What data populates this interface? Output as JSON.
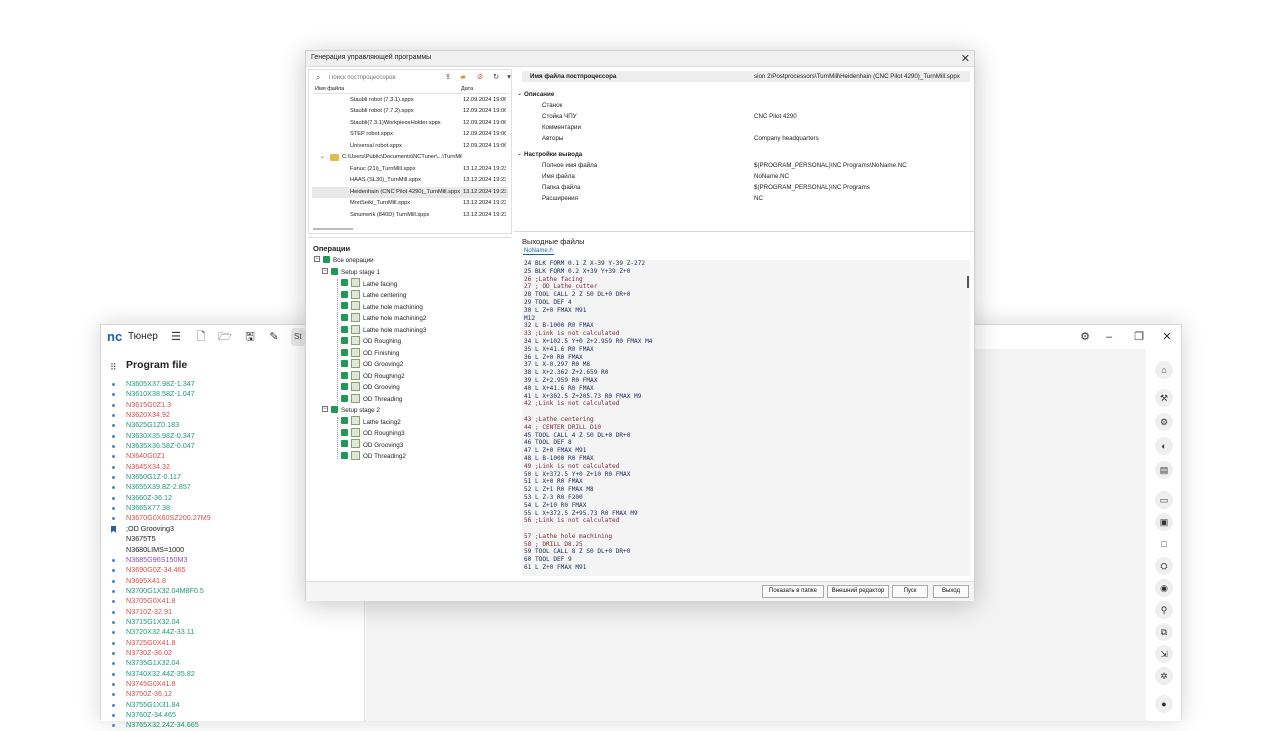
{
  "app": {
    "title": "Тюнер",
    "tab_label": "St",
    "icons": [
      "menu-icon",
      "new-file-icon",
      "open-folder-icon",
      "save-icon",
      "edit-icon"
    ],
    "program_panel": {
      "title": "Program file",
      "lines": [
        {
          "text": "N3605X37.98Z-1.347",
          "color": "green"
        },
        {
          "text": "N3610X38.58Z-1.047",
          "color": "green"
        },
        {
          "text": "N3615G0Z1.3",
          "color": "red"
        },
        {
          "text": "N3620X34.92",
          "color": "red"
        },
        {
          "text": "N3625G1Z0.183",
          "color": "green"
        },
        {
          "text": "N3630X35.98Z-0.347",
          "color": "green"
        },
        {
          "text": "N3635X36.58Z-0.047",
          "color": "green"
        },
        {
          "text": "N3640G0Z1",
          "color": "red"
        },
        {
          "text": "N3645X34.32",
          "color": "red"
        },
        {
          "text": "N3650G1Z-0.117",
          "color": "green"
        },
        {
          "text": "N3655X39.8Z-2.857",
          "color": "green"
        },
        {
          "text": "N3660Z-36.12",
          "color": "green"
        },
        {
          "text": "N3665X77.38",
          "color": "green"
        },
        {
          "text": "N3670G0X60SZ200.27M9",
          "color": "red"
        },
        {
          "text": ";OD Grooving3",
          "color": "dark",
          "bookmark": true
        },
        {
          "text": "N3675T5",
          "color": "dark",
          "nobullet": true
        },
        {
          "text": "N3680LIMS=1000",
          "color": "dark",
          "nobullet": true
        },
        {
          "text": "N3685G96S150M3",
          "color": "purple"
        },
        {
          "text": "N3690G0Z-34.465",
          "color": "red"
        },
        {
          "text": "N3695X41.8",
          "color": "red"
        },
        {
          "text": "N3700G1X32.04M8F0.5",
          "color": "green"
        },
        {
          "text": "N3705G0X41.8",
          "color": "red"
        },
        {
          "text": "N3710Z-32.91",
          "color": "red"
        },
        {
          "text": "N3715G1X32.04",
          "color": "green"
        },
        {
          "text": "N3720X32.44Z-33.11",
          "color": "green"
        },
        {
          "text": "N3725G0X41.8",
          "color": "red"
        },
        {
          "text": "N3730Z-36.02",
          "color": "red"
        },
        {
          "text": "N3735G1X32.04",
          "color": "green"
        },
        {
          "text": "N3740X32.44Z-35.82",
          "color": "green"
        },
        {
          "text": "N3745G0X41.8",
          "color": "red"
        },
        {
          "text": "N3750Z-36.12",
          "color": "red"
        },
        {
          "text": "N3755G1X31.84",
          "color": "green"
        },
        {
          "text": "N3760Z-34.465",
          "color": "green"
        },
        {
          "text": "N3765X32.24Z-34.665",
          "color": "green"
        }
      ]
    }
  },
  "dialog": {
    "title": "Генерация управляющей программы",
    "search_placeholder": "Поиск постпроцессоров",
    "pp_headers": {
      "name": "Имя файла",
      "date": "Дата"
    },
    "pp_files": [
      {
        "name": "Staubli robot (7.3.1).sppx",
        "date": "12.09.2024 19:06"
      },
      {
        "name": "Staubli robot (7.7.2).sppx",
        "date": "12.09.2024 19:06"
      },
      {
        "name": "Staubli(7.3.1)WorkpieceHolder.sppx",
        "date": "12.09.2024 19:06"
      },
      {
        "name": "STEP robot.sppx",
        "date": "12.09.2024 19:06"
      },
      {
        "name": "Universal robot.sppx",
        "date": "12.09.2024 19:06"
      },
      {
        "name": "C:\\Users\\Public\\Documents\\NCTuner\\...\\TurnMill",
        "date": "",
        "folder": true
      },
      {
        "name": "Fanuc (21i)_TurnMill.sppx",
        "date": "13.12.2024 19:23"
      },
      {
        "name": "HAAS (SL30)_TurnMill.sppx",
        "date": "13.12.2024 19:23"
      },
      {
        "name": "Heidenhain (CNC Pilot 4290)_TurnMill.sppx",
        "date": "13.12.2024 19:23",
        "selected": true
      },
      {
        "name": "MoriSeiki_TurnMill.sppx",
        "date": "13.12.2024 19:23"
      },
      {
        "name": "Sinumerik (840D) TurnMill.sppx",
        "date": "13.12.2024 19:23"
      }
    ],
    "props": [
      {
        "key": "Имя файла постпроцессора",
        "value": "sion 2\\Postprocessors\\TurnMill\\Heidenhain (CNC Pilot 4290)_TurnMill.sppx",
        "type": "head"
      },
      {
        "key": "Описание",
        "value": "",
        "type": "sec"
      },
      {
        "key": "Станок",
        "value": ""
      },
      {
        "key": "Стойка ЧПУ",
        "value": "CNC Pilot 4290"
      },
      {
        "key": "Комментарии",
        "value": ""
      },
      {
        "key": "Авторы",
        "value": "Company headquarters"
      },
      {
        "key": "Настройки вывода",
        "value": "",
        "type": "sec"
      },
      {
        "key": "Полное имя файла",
        "value": "$(PROGRAM_PERSONAL)\\NC Programs\\NoName.NC"
      },
      {
        "key": "Имя файла",
        "value": "NoName.NC"
      },
      {
        "key": "Папка файла",
        "value": "$(PROGRAM_PERSONAL)\\NC Programs"
      },
      {
        "key": "Расширения",
        "value": "NC"
      }
    ],
    "operations": {
      "title": "Операции",
      "all": "Все операции",
      "stage1": "Setup stage 1",
      "stage1_ops": [
        "Lathe facing",
        "Lathe centering",
        "Lathe hole machining",
        "Lathe hole machining2",
        "Lathe hole machining3",
        "OD Roughing",
        "OD Finishing",
        "OD Grooving2",
        "OD Roughing2",
        "OD Grooving",
        "OD Threading"
      ],
      "stage2": "Setup stage 2",
      "stage2_ops": [
        "Lathe facing2",
        "OD Roughing3",
        "OD Grooving3",
        "OD Threading2"
      ]
    },
    "output": {
      "title": "Выходные файлы",
      "tab": "NoName.h",
      "lines": [
        "24 BLK FORM 0.1 Z X-39 Y-39 Z-272",
        "25 BLK FORM 0.2 X+39 Y+39 Z+0",
        "26 ;Lathe facing",
        "27 ; OD_Lathe_cutter",
        "28 TOOL CALL 2 Z S0 DL+0 DR+0",
        "29 TOOL DEF 4",
        "30 L Z+0 FMAX M91",
        "M12",
        "32 L B-1000 R0 FMAX",
        "33 ;Link is not calculated",
        "34 L X+102.5 Y+0 Z+2.959 R0 FMAX M4",
        "35 L X+41.6 R0 FMAX",
        "36 L Z+0 R0 FMAX",
        "37 L X-0.297 R0 M8",
        "38 L X+2.362 Z+2.659 R0",
        "39 L Z+2.959 R0 FMAX",
        "40 L X+41.6 R0 FMAX",
        "41 L X+302.5 Z+205.73 R0 FMAX M9",
        "42 ;Link is not calculated",
        "",
        "43 ;Lathe centering",
        "44 ; CENTER_DRILL D10",
        "45 TOOL CALL 4 Z S0 DL+0 DR+0",
        "46 TOOL DEF 8",
        "47 L Z+0 FMAX M91",
        "48 L B-1000 R0 FMAX",
        "49 ;Link is not calculated",
        "50 L X+372.5 Y+0 Z+10 R0 FMAX",
        "51 L X+0 R0 FMAX",
        "52 L Z+1 R0 FMAX M8",
        "53 L Z-3 R0 F200",
        "54 L Z+10 R0 FMAX",
        "55 L X+372.5 Z+95.73 R0 FMAX M9",
        "56 ;Link is not calculated",
        "",
        "57 ;Lathe hole machining",
        "58 ; DRILL D8.25",
        "59 TOOL CALL 8 Z S0 DL+0 DR+0",
        "60 TOOL DEF 9",
        "61 L Z+0 FMAX M91"
      ]
    },
    "buttons": {
      "show_folder": "Показать в папке",
      "external_editor": "Внешний редактор",
      "run": "Пуск",
      "exit": "Выход"
    }
  }
}
